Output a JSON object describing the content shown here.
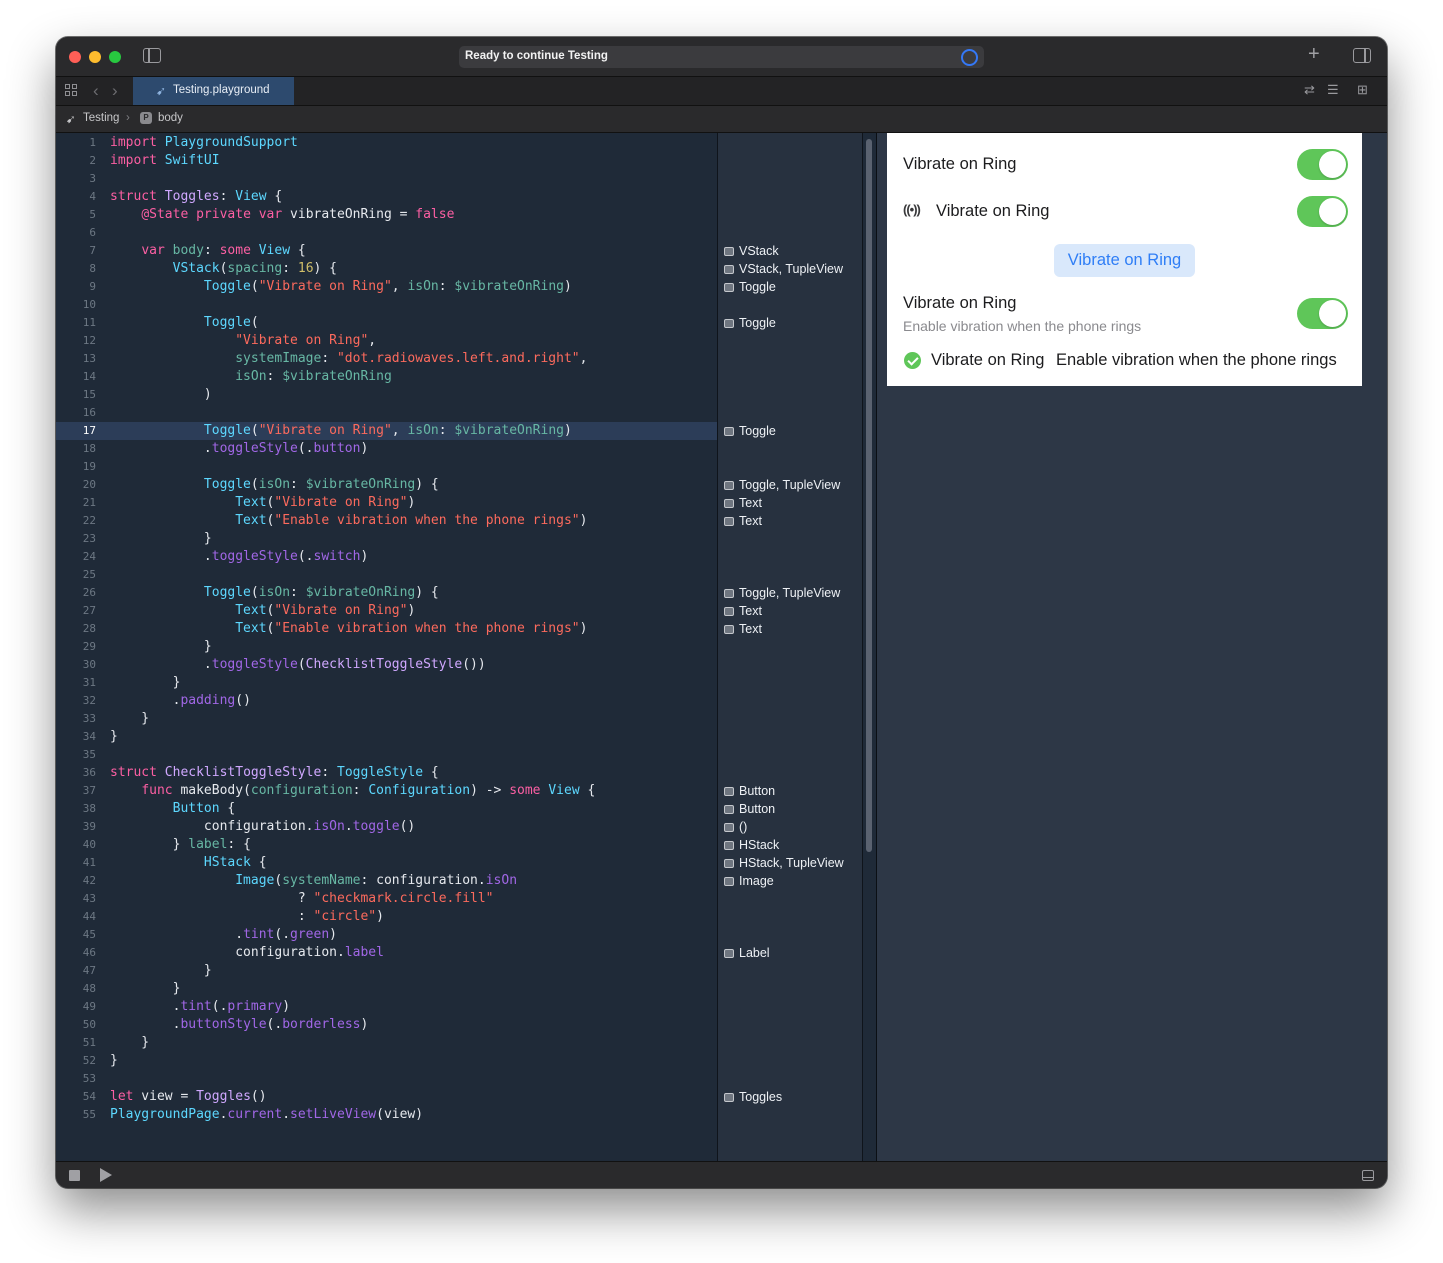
{
  "window": {
    "activity_text": "Ready to continue Testing",
    "tab_label": "Testing.playground",
    "breadcrumb": [
      "Testing",
      "body"
    ],
    "breadcrumb_icon_letter": "P"
  },
  "editor": {
    "current_line": 17,
    "lines": [
      "import PlaygroundSupport",
      "import SwiftUI",
      "",
      "struct Toggles: View {",
      "    @State private var vibrateOnRing = false",
      "",
      "    var body: some View {",
      "        VStack(spacing: 16) {",
      "            Toggle(\"Vibrate on Ring\", isOn: $vibrateOnRing)",
      "",
      "            Toggle(",
      "                \"Vibrate on Ring\",",
      "                systemImage: \"dot.radiowaves.left.and.right\",",
      "                isOn: $vibrateOnRing",
      "            )",
      "",
      "            Toggle(\"Vibrate on Ring\", isOn: $vibrateOnRing)",
      "            .toggleStyle(.button)",
      "",
      "            Toggle(isOn: $vibrateOnRing) {",
      "                Text(\"Vibrate on Ring\")",
      "                Text(\"Enable vibration when the phone rings\")",
      "            }",
      "            .toggleStyle(.switch)",
      "",
      "            Toggle(isOn: $vibrateOnRing) {",
      "                Text(\"Vibrate on Ring\")",
      "                Text(\"Enable vibration when the phone rings\")",
      "            }",
      "            .toggleStyle(ChecklistToggleStyle())",
      "        }",
      "        .padding()",
      "    }",
      "}",
      "",
      "struct ChecklistToggleStyle: ToggleStyle {",
      "    func makeBody(configuration: Configuration) -> some View {",
      "        Button {",
      "            configuration.isOn.toggle()",
      "        } label: {",
      "            HStack {",
      "                Image(systemName: configuration.isOn",
      "                        ? \"checkmark.circle.fill\"",
      "                        : \"circle\")",
      "                .tint(.green)",
      "                configuration.label",
      "            }",
      "        }",
      "        .tint(.primary)",
      "        .buttonStyle(.borderless)",
      "    }",
      "}",
      "",
      "let view = Toggles()",
      "PlaygroundPage.current.setLiveView(view)"
    ]
  },
  "results": [
    {
      "line": 7,
      "label": "VStack"
    },
    {
      "line": 8,
      "label": "VStack, TupleView"
    },
    {
      "line": 9,
      "label": "Toggle"
    },
    {
      "line": 11,
      "label": "Toggle"
    },
    {
      "line": 17,
      "label": "Toggle"
    },
    {
      "line": 20,
      "label": "Toggle, TupleView"
    },
    {
      "line": 21,
      "label": "Text"
    },
    {
      "line": 22,
      "label": "Text"
    },
    {
      "line": 26,
      "label": "Toggle, TupleView"
    },
    {
      "line": 27,
      "label": "Text"
    },
    {
      "line": 28,
      "label": "Text"
    },
    {
      "line": 37,
      "label": "Button"
    },
    {
      "line": 38,
      "label": "Button"
    },
    {
      "line": 39,
      "label": "()"
    },
    {
      "line": 40,
      "label": "HStack"
    },
    {
      "line": 41,
      "label": "HStack, TupleView"
    },
    {
      "line": 42,
      "label": "Image"
    },
    {
      "line": 46,
      "label": "Label"
    },
    {
      "line": 54,
      "label": "Toggles"
    }
  ],
  "live_view": {
    "toggle1_label": "Vibrate on Ring",
    "toggle2_label": "Vibrate on Ring",
    "toggle2_icon": "dot-radiowaves-icon",
    "toggle3_button_label": "Vibrate on Ring",
    "toggle4_title": "Vibrate on Ring",
    "toggle4_subtitle": "Enable vibration when the phone rings",
    "toggle5_title": "Vibrate on Ring",
    "toggle5_subtitle": "Enable vibration when the phone rings",
    "toggle_on_color": "#5fc659",
    "button_tint": "#2f7ef6"
  }
}
